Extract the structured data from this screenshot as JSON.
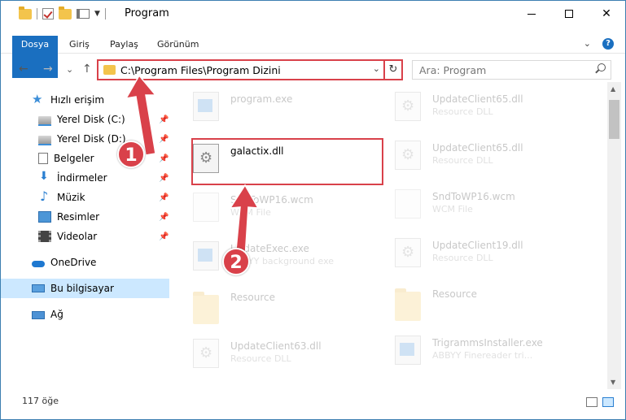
{
  "window": {
    "title": "Program",
    "controls": {
      "minimize": "",
      "maximize": "",
      "close": "✕"
    }
  },
  "ribbon": {
    "tabs": [
      "Dosya",
      "Giriş",
      "Paylaş",
      "Görünüm"
    ],
    "expand": "⌄",
    "help": "?"
  },
  "nav": {
    "back": "←",
    "forward": "→",
    "recent": "⌄",
    "up": "↑",
    "address": "C:\\Program Files\\Program Dizini",
    "address_drop": "⌄",
    "refresh": "↻",
    "search_placeholder": "Ara: Program"
  },
  "sidebar": {
    "items": [
      {
        "label": "Hızlı erişim",
        "icon": "star-icon"
      },
      {
        "label": "Yerel Disk (C:)",
        "icon": "disk-icon",
        "pinned": true
      },
      {
        "label": "Yerel Disk (D:)",
        "icon": "disk-icon",
        "pinned": true
      },
      {
        "label": "Belgeler",
        "icon": "document-icon",
        "pinned": true
      },
      {
        "label": "İndirmeler",
        "icon": "download-icon",
        "pinned": true
      },
      {
        "label": "Müzik",
        "icon": "music-icon",
        "pinned": true
      },
      {
        "label": "Resimler",
        "icon": "picture-icon",
        "pinned": true
      },
      {
        "label": "Videolar",
        "icon": "video-icon",
        "pinned": true
      },
      {
        "label": "OneDrive",
        "icon": "cloud-icon"
      },
      {
        "label": "Bu bilgisayar",
        "icon": "computer-icon",
        "selected": true
      },
      {
        "label": "Ağ",
        "icon": "network-icon"
      }
    ]
  },
  "files": {
    "left": [
      {
        "name": "program.exe",
        "type": "",
        "kind": "exe"
      },
      {
        "name": "galactix.dll",
        "type": "",
        "kind": "dll"
      },
      {
        "name": "SndToWP16.wcm",
        "type": "WCM File",
        "kind": "wcm"
      },
      {
        "name": "UpdateExec.exe",
        "type": "ABBYY background exe",
        "kind": "exe"
      },
      {
        "name": "Resource",
        "type": "",
        "kind": "folder"
      },
      {
        "name": "UpdateClient63.dll",
        "type": "Resource DLL",
        "kind": "dll"
      }
    ],
    "right": [
      {
        "name": "UpdateClient65.dll",
        "type": "Resource DLL",
        "kind": "dll"
      },
      {
        "name": "UpdateClient65.dll",
        "type": "Resource DLL",
        "kind": "dll"
      },
      {
        "name": "SndToWP16.wcm",
        "type": "WCM File",
        "kind": "wcm"
      },
      {
        "name": "UpdateClient19.dll",
        "type": "Resource DLL",
        "kind": "dll"
      },
      {
        "name": "Resource",
        "type": "",
        "kind": "folder"
      },
      {
        "name": "TrigrammsInstaller.exe",
        "type": "ABBYY Finereader tri...",
        "kind": "exe"
      }
    ]
  },
  "status": {
    "count": "117 öğe"
  },
  "annotations": {
    "step1": "1",
    "step2": "2",
    "color": "#d9414a"
  }
}
